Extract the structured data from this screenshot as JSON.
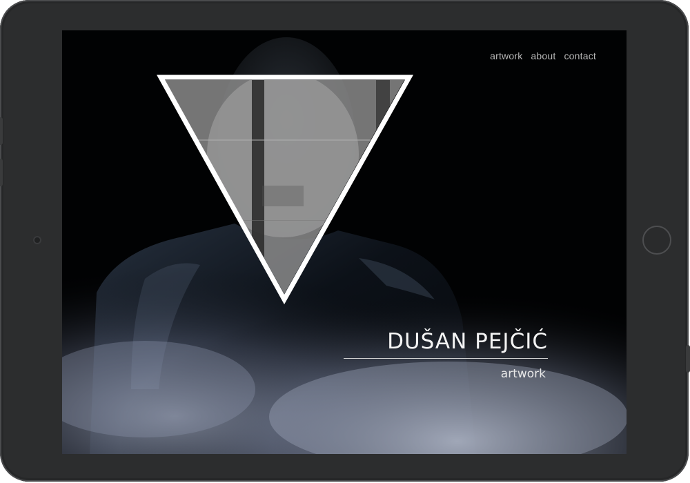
{
  "nav": {
    "items": [
      {
        "label": "artwork"
      },
      {
        "label": "about"
      },
      {
        "label": "contact"
      }
    ]
  },
  "hero": {
    "title": "DUŠAN PEJČIĆ",
    "subtitle": "artwork"
  },
  "colors": {
    "screen_background": "#000000",
    "device_frame": "#2c2d2e",
    "nav_text": "#b8b8b8",
    "title_text": "#f4f4f4",
    "triangle_border": "#ffffff"
  }
}
